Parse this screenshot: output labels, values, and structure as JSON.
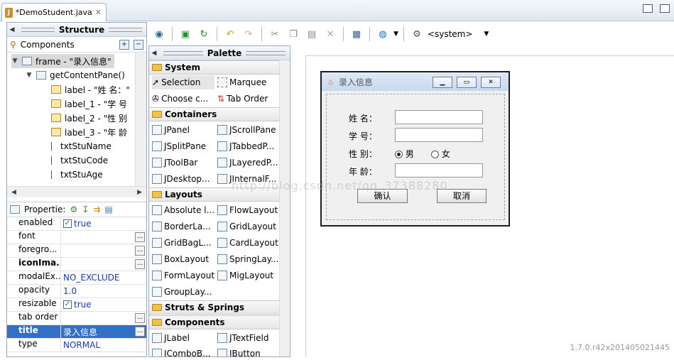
{
  "editor": {
    "tab_label": "*DemoStudent.java",
    "close_glyph": "✕"
  },
  "structure": {
    "title": "Structure",
    "components_label": "Components",
    "tree": [
      {
        "label": "frame - \"录入信息\"",
        "type": "frame"
      },
      {
        "label": "getContentPane()",
        "type": "pane"
      },
      {
        "label": "label - \"姓 名：\"",
        "type": "label"
      },
      {
        "label": "label_1 - \"学 号",
        "type": "label"
      },
      {
        "label": "label_2 - \"性 别",
        "type": "label"
      },
      {
        "label": "label_3 - \"年 龄",
        "type": "label"
      },
      {
        "label": "txtStuName",
        "type": "text"
      },
      {
        "label": "txtStuCode",
        "type": "text"
      },
      {
        "label": "txtStuAge",
        "type": "text"
      }
    ]
  },
  "properties": {
    "title": "Propertie:",
    "rows": [
      {
        "key": "enabled",
        "value": "true",
        "checkbox": true
      },
      {
        "key": "font",
        "value": "",
        "dots": true
      },
      {
        "key": "foregro...",
        "value": "",
        "dots": true
      },
      {
        "key": "iconIma...",
        "value": "",
        "dots": true,
        "bold": true
      },
      {
        "key": "modalEx...",
        "value": "NO_EXCLUDE"
      },
      {
        "key": "opacity",
        "value": "1.0"
      },
      {
        "key": "resizable",
        "value": "true",
        "checkbox": true
      },
      {
        "key": "tab order",
        "value": "",
        "dots": true
      },
      {
        "key": "title",
        "value": "录入信息",
        "dots": true,
        "selected": true
      },
      {
        "key": "type",
        "value": "NORMAL"
      }
    ]
  },
  "toolbar": {
    "system_label": "<system>"
  },
  "palette": {
    "title": "Palette",
    "categories": [
      {
        "name": "System",
        "items": [
          "Selection",
          "Marquee",
          "Choose c...",
          "Tab Order"
        ]
      },
      {
        "name": "Containers",
        "items": [
          "JPanel",
          "JScrollPane",
          "JSplitPane",
          "JTabbedP...",
          "JToolBar",
          "JLayeredP...",
          "JDesktop...",
          "JInternalF..."
        ]
      },
      {
        "name": "Layouts",
        "items": [
          "Absolute l...",
          "FlowLayout",
          "BorderLa...",
          "GridLayout",
          "GridBagL...",
          "CardLayout",
          "BoxLayout",
          "SpringLay...",
          "FormLayout",
          "MigLayout",
          "GroupLay..."
        ]
      },
      {
        "name": "Struts & Springs",
        "items": []
      },
      {
        "name": "Components",
        "items": [
          "JLabel",
          "JTextField",
          "JComboB...",
          "JButton"
        ]
      }
    ]
  },
  "form": {
    "title": "录入信息",
    "name_label": "姓  名：",
    "code_label": "学  号：",
    "gender_label": "性  别：",
    "age_label": "年  龄：",
    "male": "男",
    "female": "女",
    "confirm": "确认",
    "cancel": "取消"
  },
  "watermark": "http://blog.csdn.net/qq_37388280",
  "version": "1.7.0.r42x201405021445"
}
